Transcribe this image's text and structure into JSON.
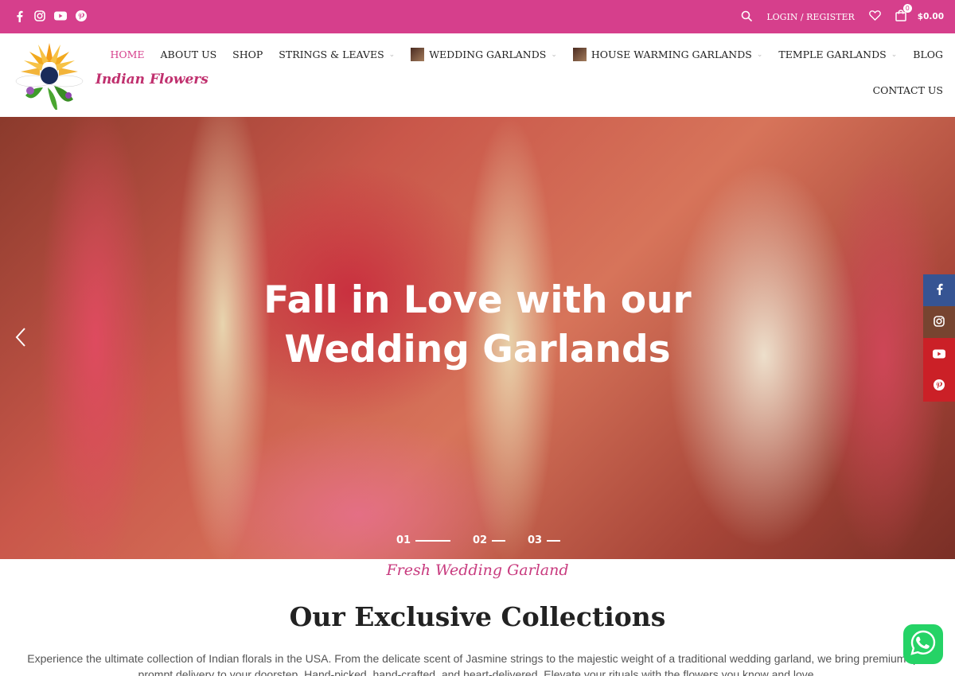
{
  "topbar": {
    "social_icons": [
      "facebook-icon",
      "instagram-icon",
      "youtube-icon",
      "pinterest-icon"
    ],
    "login_label": "LOGIN / REGISTER",
    "cart_count": "0",
    "cart_total": "$0.00",
    "color": "#d63f8c"
  },
  "header": {
    "logo_text": "Indian Flowers",
    "nav": [
      {
        "label": "HOME"
      },
      {
        "label": "ABOUT US"
      },
      {
        "label": "SHOP"
      },
      {
        "label": "STRINGS & LEAVES"
      },
      {
        "label": "WEDDING GARLANDS"
      },
      {
        "label": "HOUSE WARMING GARLANDS"
      },
      {
        "label": "TEMPLE GARLANDS"
      },
      {
        "label": "BLOG"
      },
      {
        "label": "CONTACT US"
      }
    ]
  },
  "hero": {
    "title_line1": "Fall in Love with our",
    "title_line2": "Wedding Garlands",
    "slides": [
      "01",
      "02",
      "03"
    ]
  },
  "section": {
    "script_text": "Fresh Wedding Garland",
    "heading": "Our Exclusive Collections",
    "intro_line1": "Experience the ultimate collection of Indian florals in the USA. From the delicate scent of Jasmine strings to the majestic weight of a traditional wedding garland, we bring premium qua",
    "intro_line2": "prompt delivery to your doorstep. Hand-picked, hand-crafted, and heart-delivered. Elevate your rituals with the flowers you know and love."
  },
  "side_social": [
    {
      "icon": "facebook-icon",
      "color": "#365493"
    },
    {
      "icon": "instagram-icon",
      "color": "#774430"
    },
    {
      "icon": "youtube-icon",
      "color": "#cb2027"
    },
    {
      "icon": "pinterest-icon",
      "color": "#cb2027"
    }
  ]
}
